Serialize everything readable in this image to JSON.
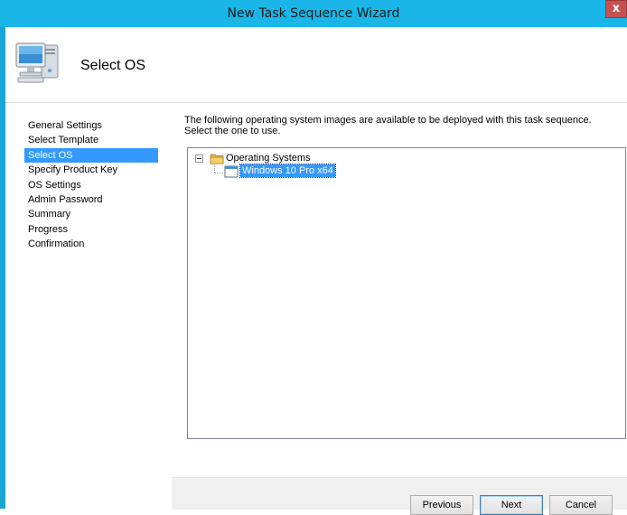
{
  "window": {
    "title": "New Task Sequence Wizard",
    "close_label": "x"
  },
  "header": {
    "title": "Select OS",
    "icon": "computer-icon"
  },
  "steps": [
    {
      "label": "General Settings",
      "active": false
    },
    {
      "label": "Select Template",
      "active": false
    },
    {
      "label": "Select OS",
      "active": true
    },
    {
      "label": "Specify Product Key",
      "active": false
    },
    {
      "label": "OS Settings",
      "active": false
    },
    {
      "label": "Admin Password",
      "active": false
    },
    {
      "label": "Summary",
      "active": false
    },
    {
      "label": "Progress",
      "active": false
    },
    {
      "label": "Confirmation",
      "active": false
    }
  ],
  "main": {
    "instructions": "The following operating system images are available to be deployed with this task sequence.  Select the one to use.",
    "tree": {
      "root_label": "Operating Systems",
      "root_icon": "folder-icon",
      "children": [
        {
          "label": "Windows 10 Pro x64",
          "selected": true,
          "icon": "os-image-icon"
        }
      ]
    }
  },
  "buttons": {
    "previous": "Previous",
    "next": "Next",
    "cancel": "Cancel"
  },
  "colors": {
    "title_bar": "#19b6e7",
    "selection": "#3399ff"
  }
}
